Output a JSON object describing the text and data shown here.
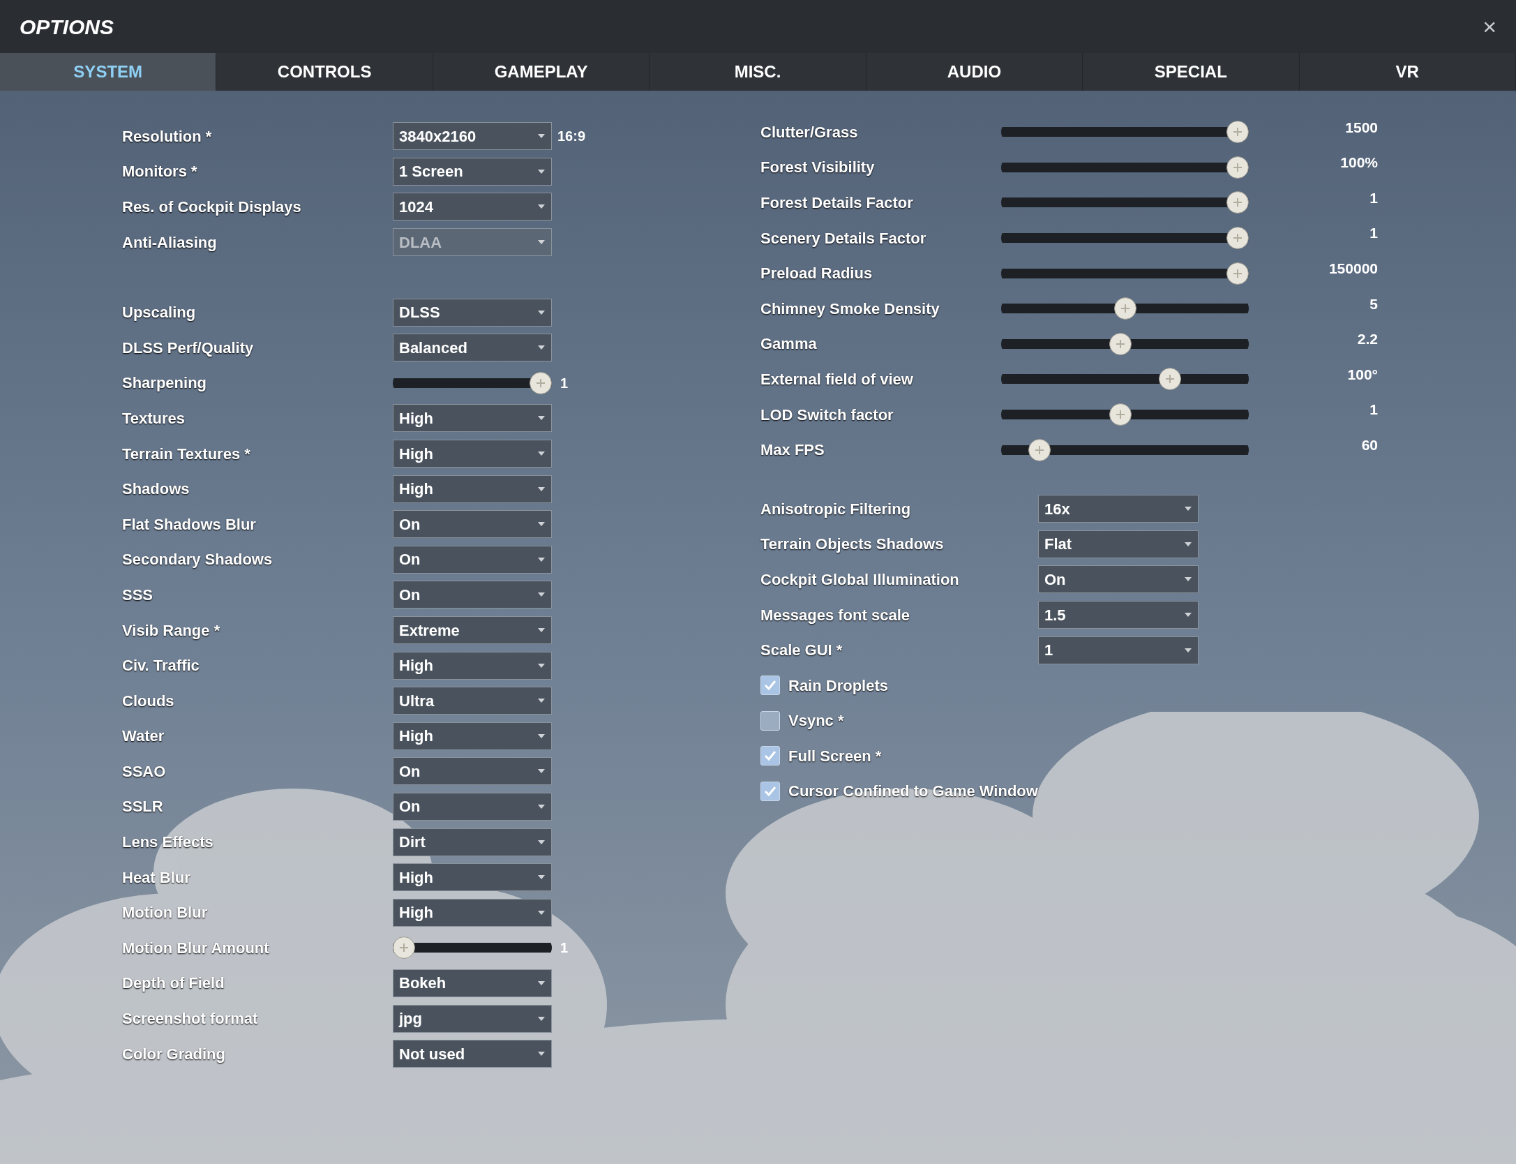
{
  "window": {
    "title": "OPTIONS",
    "close": "×"
  },
  "tabs": [
    {
      "label": "SYSTEM",
      "selected": true
    },
    {
      "label": "CONTROLS",
      "selected": false
    },
    {
      "label": "GAMEPLAY",
      "selected": false
    },
    {
      "label": "MISC.",
      "selected": false
    },
    {
      "label": "AUDIO",
      "selected": false
    },
    {
      "label": "SPECIAL",
      "selected": false
    },
    {
      "label": "VR",
      "selected": false
    }
  ],
  "left_groups": [
    [
      {
        "kind": "dropdown",
        "label": "Resolution *",
        "value": "3840x2160",
        "note": "16:9",
        "disabled": false
      },
      {
        "kind": "dropdown",
        "label": "Monitors *",
        "value": "1 Screen",
        "disabled": false
      },
      {
        "kind": "dropdown",
        "label": "Res. of Cockpit Displays",
        "value": "1024",
        "disabled": false
      },
      {
        "kind": "dropdown",
        "label": "Anti-Aliasing",
        "value": "DLAA",
        "disabled": true
      }
    ],
    [
      {
        "kind": "dropdown",
        "label": "Upscaling",
        "value": "DLSS",
        "disabled": false
      },
      {
        "kind": "dropdown",
        "label": "DLSS Perf/Quality",
        "value": "Balanced",
        "disabled": false
      },
      {
        "kind": "slider",
        "label": "Sharpening",
        "level": 1,
        "reading": "1"
      },
      {
        "kind": "dropdown",
        "label": "Textures",
        "value": "High",
        "disabled": false
      },
      {
        "kind": "dropdown",
        "label": "Terrain Textures *",
        "value": "High",
        "disabled": false
      },
      {
        "kind": "dropdown",
        "label": "Shadows",
        "value": "High",
        "disabled": false
      },
      {
        "kind": "dropdown",
        "label": "Flat Shadows Blur",
        "value": "On",
        "disabled": false
      },
      {
        "kind": "dropdown",
        "label": "Secondary Shadows",
        "value": "On",
        "disabled": false
      },
      {
        "kind": "dropdown",
        "label": "SSS",
        "value": "On",
        "disabled": false
      },
      {
        "kind": "dropdown",
        "label": "Visib Range *",
        "value": "Extreme",
        "disabled": false
      },
      {
        "kind": "dropdown",
        "label": "Civ. Traffic",
        "value": "High",
        "disabled": false
      },
      {
        "kind": "dropdown",
        "label": "Clouds",
        "value": "Ultra",
        "disabled": false
      },
      {
        "kind": "dropdown",
        "label": "Water",
        "value": "High",
        "disabled": false
      },
      {
        "kind": "dropdown",
        "label": "SSAO",
        "value": "On",
        "disabled": false
      },
      {
        "kind": "dropdown",
        "label": "SSLR",
        "value": "On",
        "disabled": false
      },
      {
        "kind": "dropdown",
        "label": "Lens Effects",
        "value": "Dirt",
        "disabled": false
      },
      {
        "kind": "dropdown",
        "label": "Heat Blur",
        "value": "High",
        "disabled": false
      },
      {
        "kind": "dropdown",
        "label": "Motion Blur",
        "value": "High",
        "disabled": false
      },
      {
        "kind": "slider",
        "label": "Motion Blur Amount",
        "level": 0,
        "reading": "1"
      },
      {
        "kind": "dropdown",
        "label": "Depth of Field",
        "value": "Bokeh",
        "disabled": false
      },
      {
        "kind": "dropdown",
        "label": "Screenshot format",
        "value": "jpg",
        "disabled": false
      },
      {
        "kind": "dropdown",
        "label": "Color Grading",
        "value": "Not used",
        "disabled": false
      }
    ]
  ],
  "sliders": [
    {
      "label": "Clutter/Grass",
      "level": 1,
      "reading": "1500"
    },
    {
      "label": "Forest Visibility",
      "level": 1,
      "reading": "100%"
    },
    {
      "label": "Forest Details Factor",
      "level": 1,
      "reading": "1"
    },
    {
      "label": "Scenery Details Factor",
      "level": 1,
      "reading": "1"
    },
    {
      "label": "Preload Radius",
      "level": 1,
      "reading": "150000"
    },
    {
      "label": "Chimney Smoke Density",
      "level": 0.5,
      "reading": "5"
    },
    {
      "label": "Gamma",
      "level": 0.48,
      "reading": "2.2"
    },
    {
      "label": "External field of view",
      "level": 0.7,
      "reading": "100°"
    },
    {
      "label": "LOD Switch factor",
      "level": 0.48,
      "reading": "1"
    },
    {
      "label": "Max FPS",
      "level": 0.12,
      "reading": "60"
    }
  ],
  "dropdowns": [
    {
      "label": "Anisotropic Filtering",
      "value": "16x"
    },
    {
      "label": "Terrain Objects Shadows",
      "value": "Flat"
    },
    {
      "label": "Cockpit Global Illumination",
      "value": "On"
    },
    {
      "label": "Messages font scale",
      "value": "1.5"
    },
    {
      "label": "Scale GUI *",
      "value": "1"
    }
  ],
  "checkboxes": [
    {
      "label": "Rain Droplets",
      "checked": true
    },
    {
      "label": "Vsync *",
      "checked": false
    },
    {
      "label": "Full Screen *",
      "checked": true
    },
    {
      "label": "Cursor Confined to Game Window",
      "checked": true
    }
  ]
}
